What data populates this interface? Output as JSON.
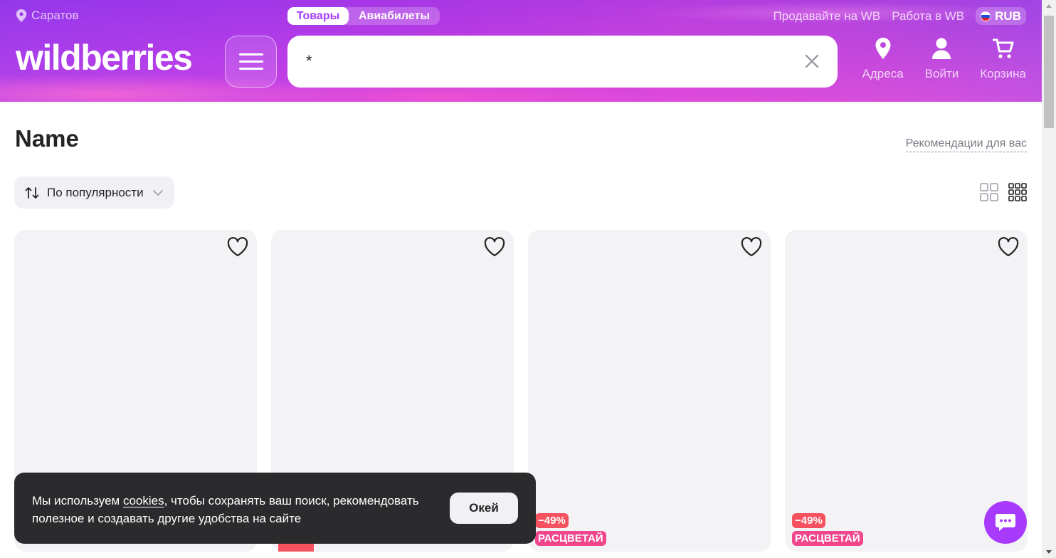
{
  "header": {
    "city": "Саратов",
    "tabs": [
      {
        "label": "Товары",
        "active": true
      },
      {
        "label": "Авиабилеты",
        "active": false
      }
    ],
    "top_links": [
      "Продавайте на WB",
      "Работа в WB"
    ],
    "currency": "RUB",
    "logo_text": "wildberries",
    "search": {
      "value": "*",
      "placeholder": ""
    },
    "icons": [
      {
        "icon": "pin-icon",
        "label": "Адреса"
      },
      {
        "icon": "user-icon",
        "label": "Войти"
      },
      {
        "icon": "cart-icon",
        "label": "Корзина"
      }
    ],
    "colors": {
      "accent": "#a73afd",
      "header_gradient_start": "#a23ff3",
      "header_gradient_end": "#d548e0"
    }
  },
  "main": {
    "title": "Name",
    "recommendations_link": "Рекомендации для вас",
    "sort_label": "По популярности",
    "view_modes": [
      "grid-4-icon",
      "grid-9-icon"
    ],
    "active_view": "grid-9-icon",
    "cards": [
      {
        "discount": "",
        "promo": ""
      },
      {
        "discount": "",
        "promo": ""
      },
      {
        "discount": "−49%",
        "promo": "РАСЦВЕТАЙ"
      },
      {
        "discount": "−49%",
        "promo": "РАСЦВЕТАЙ"
      }
    ]
  },
  "cookie": {
    "text_before": "Мы используем ",
    "link": "cookies",
    "text_after": ", чтобы сохранять ваш поиск, рекомендовать полезное и создавать другие удобства на сайте",
    "button": "Окей"
  },
  "chat": {
    "icon": "chat-icon"
  }
}
